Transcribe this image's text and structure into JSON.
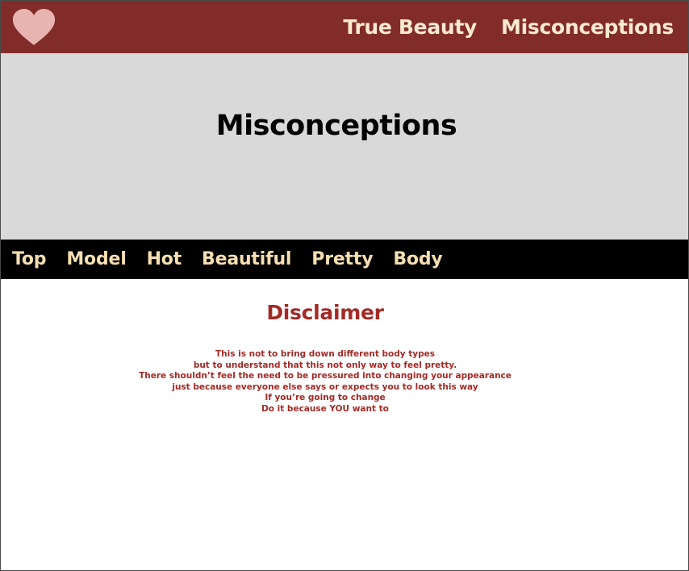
{
  "header": {
    "logo_icon": "heart-icon",
    "brand_color": "#812c29",
    "nav": [
      {
        "label": "True Beauty"
      },
      {
        "label": "Misconceptions"
      }
    ]
  },
  "hero": {
    "title": "Misconceptions"
  },
  "subnav": {
    "items": [
      {
        "label": "Top"
      },
      {
        "label": "Model"
      },
      {
        "label": "Hot"
      },
      {
        "label": "Beautiful"
      },
      {
        "label": "Pretty"
      },
      {
        "label": "Body"
      }
    ]
  },
  "content": {
    "heading": "Disclaimer",
    "lines": [
      "This is not to bring down different body types",
      "but to understand that this not only way to feel pretty.",
      "There shouldn’t feel the need to be pressured into changing your appearance",
      "just because everyone else says or expects you to look this way",
      "If you’re going to change",
      "Do it because YOU want to"
    ],
    "accent_color": "#a32a26"
  }
}
